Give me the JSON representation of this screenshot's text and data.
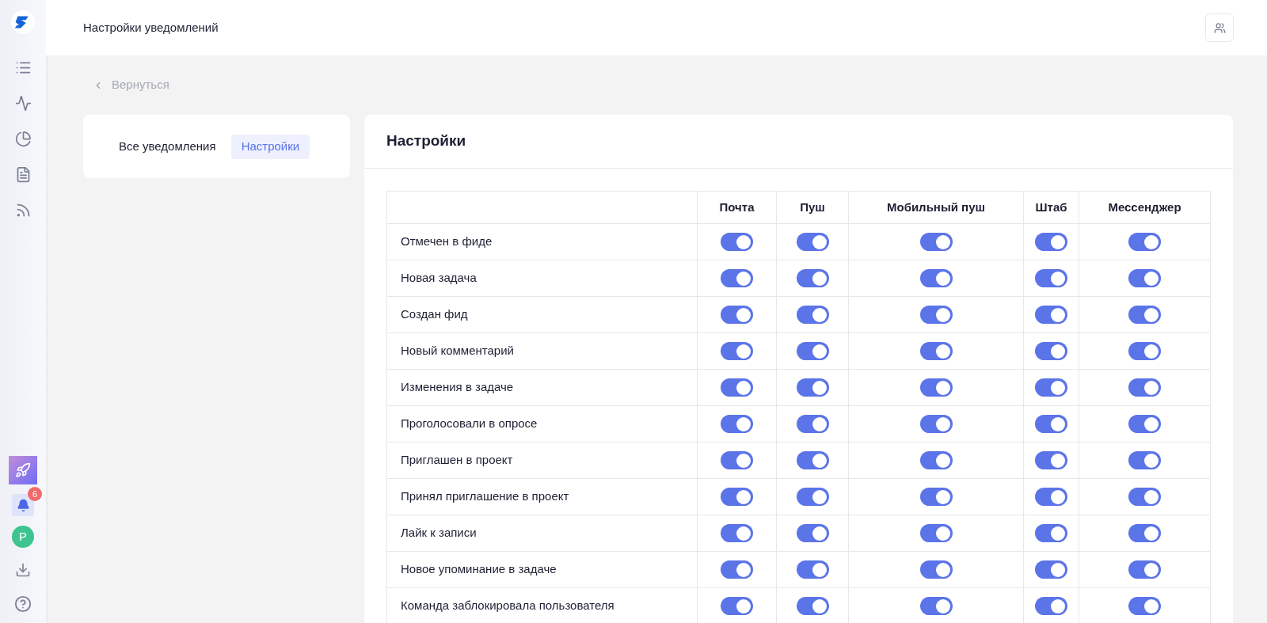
{
  "header": {
    "title": "Настройки уведомлений"
  },
  "sidebar": {
    "notifications_badge": "6",
    "avatar_letter": "P"
  },
  "back_link": "Вернуться",
  "tabs": [
    {
      "label": "Все уведомления",
      "selected": false
    },
    {
      "label": "Настройки",
      "selected": true
    }
  ],
  "panel": {
    "title": "Настройки"
  },
  "table": {
    "columns": [
      "Почта",
      "Пуш",
      "Мобильный пуш",
      "Штаб",
      "Мессенджер"
    ],
    "rows": [
      {
        "label": "Отмечен в фиде",
        "toggles": [
          {
            "on": true
          },
          {
            "on": true
          },
          {
            "on": true
          },
          {
            "on": true
          },
          {
            "on": true
          }
        ]
      },
      {
        "label": "Новая задача",
        "toggles": [
          {
            "on": true
          },
          {
            "on": true
          },
          {
            "on": true
          },
          {
            "on": true
          },
          {
            "on": true
          }
        ]
      },
      {
        "label": "Создан фид",
        "toggles": [
          {
            "on": true
          },
          {
            "on": true
          },
          {
            "on": true
          },
          {
            "on": true
          },
          {
            "on": true
          }
        ]
      },
      {
        "label": "Новый комментарий",
        "toggles": [
          {
            "on": true
          },
          {
            "on": true
          },
          {
            "on": true
          },
          {
            "on": true
          },
          {
            "on": true
          }
        ]
      },
      {
        "label": "Изменения в задаче",
        "toggles": [
          {
            "on": true
          },
          {
            "on": true
          },
          {
            "on": true
          },
          {
            "on": true
          },
          {
            "on": true
          }
        ]
      },
      {
        "label": "Проголосовали в опросе",
        "toggles": [
          {
            "on": true
          },
          {
            "on": true
          },
          {
            "on": true
          },
          {
            "on": true
          },
          {
            "on": true
          }
        ]
      },
      {
        "label": "Приглашен в проект",
        "toggles": [
          {
            "on": true
          },
          {
            "on": true
          },
          {
            "on": true
          },
          {
            "on": true
          },
          {
            "on": true
          }
        ]
      },
      {
        "label": "Принял приглашение в проект",
        "toggles": [
          {
            "on": true
          },
          {
            "on": true
          },
          {
            "on": true
          },
          {
            "on": true
          },
          {
            "on": true
          }
        ]
      },
      {
        "label": "Лайк к записи",
        "toggles": [
          {
            "on": true
          },
          {
            "on": true
          },
          {
            "on": true
          },
          {
            "on": true
          },
          {
            "on": true
          }
        ]
      },
      {
        "label": "Новое упоминание в задаче",
        "toggles": [
          {
            "on": true
          },
          {
            "on": true
          },
          {
            "on": true
          },
          {
            "on": true
          },
          {
            "on": true
          }
        ]
      },
      {
        "label": "Команда заблокировала пользователя",
        "toggles": [
          {
            "on": true
          },
          {
            "on": true
          },
          {
            "on": true
          },
          {
            "on": true
          },
          {
            "on": true
          }
        ]
      }
    ]
  }
}
